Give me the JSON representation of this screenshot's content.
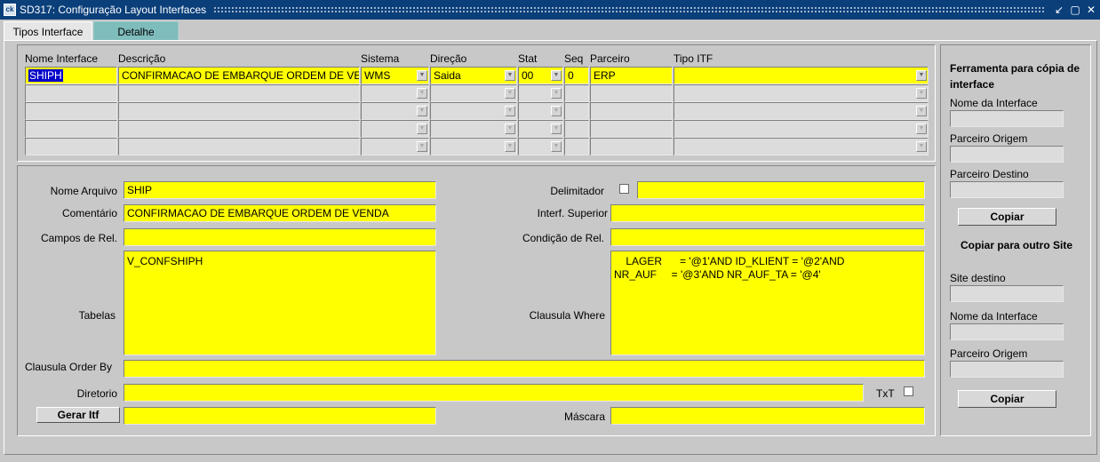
{
  "window": {
    "title": "SD317: Configuração Layout Interfaces",
    "app_icon_text": "ck"
  },
  "tabs": [
    {
      "label": "Tipos Interface",
      "active": true
    },
    {
      "label": "Detalhe",
      "active": false
    }
  ],
  "grid": {
    "headers": {
      "nome": "Nome Interface",
      "descricao": "Descrição",
      "sistema": "Sistema",
      "direcao": "Direção",
      "stat": "Stat",
      "seq": "Seq",
      "parceiro": "Parceiro",
      "tipo": "Tipo ITF"
    },
    "row1": {
      "nome": "SHIPH",
      "descricao": "CONFIRMACAO DE EMBARQUE ORDEM DE VENDA",
      "sistema": "WMS",
      "direcao": "Saida",
      "stat": "00",
      "seq": "0",
      "parceiro": "ERP",
      "tipo": ""
    }
  },
  "detail": {
    "labels": {
      "nome_arquivo": "Nome Arquivo",
      "comentario": "Comentário",
      "campos_rel": "Campos de Rel.",
      "tabelas": "Tabelas",
      "order_by": "Clausula Order By",
      "diretorio": "Diretorio",
      "delimitador": "Delimitador",
      "interf_superior": "Interf. Superior",
      "condicao_rel": "Condição de Rel.",
      "where": "Clausula Where",
      "txt": "TxT",
      "mascara": "Máscara"
    },
    "values": {
      "nome_arquivo": "SHIP",
      "comentario": "CONFIRMACAO DE EMBARQUE ORDEM DE VENDA",
      "campos_rel": "",
      "tabelas": "V_CONFSHIPH",
      "order_by": "",
      "diretorio": "",
      "delimitador": "",
      "interf_superior": "",
      "condicao_rel": "",
      "where": "    LAGER      = '@1'AND ID_KLIENT = '@2'AND\nNR_AUF     = '@3'AND NR_AUF_TA = '@4'",
      "gerar_itf": "",
      "mascara": ""
    },
    "gerar_button": "Gerar Itf"
  },
  "tool": {
    "title1": "Ferramenta para cópia de interface",
    "nome_interface": "Nome da Interface",
    "parceiro_origem": "Parceiro Origem",
    "parceiro_destino": "Parceiro Destino",
    "copiar1": "Copiar",
    "title2": "Copiar para outro Site",
    "site_destino": "Site destino",
    "nome_interface2": "Nome da Interface",
    "parceiro_origem2": "Parceiro Origem",
    "copiar2": "Copiar"
  },
  "colors": {
    "titlebar": "#0a3f7a",
    "field_yellow": "#ffff00",
    "tab_active": "#7fbcbc"
  }
}
